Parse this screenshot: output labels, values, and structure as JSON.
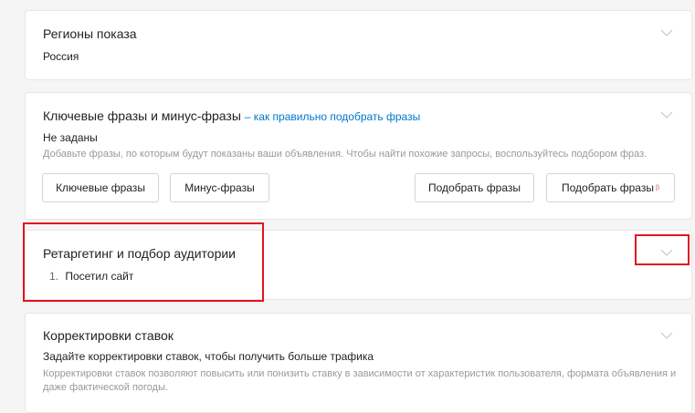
{
  "regions": {
    "title": "Регионы показа",
    "value": "Россия"
  },
  "keywords": {
    "title": "Ключевые фразы и минус-фразы",
    "link": "– как правильно подобрать фразы",
    "status": "Не заданы",
    "hint": "Добавьте фразы, по которым будут показаны ваши объявления. Чтобы найти похожие запросы, воспользуйтесь подбором фраз.",
    "buttons": {
      "keywords": "Ключевые фразы",
      "minus": "Минус-фразы",
      "pick": "Подобрать фразы",
      "pick_beta": "Подобрать фразы",
      "beta_mark": "β"
    }
  },
  "retargeting": {
    "title": "Ретаргетинг и подбор аудитории",
    "items": [
      {
        "num": "1.",
        "label": "Посетил сайт"
      }
    ]
  },
  "bids": {
    "title": "Корректировки ставок",
    "subtitle": "Задайте корректировки ставок, чтобы получить больше трафика",
    "hint": "Корректировки ставок позволяют повысить или понизить ставку в зависимости от характеристик пользователя, формата объявления и даже фактической погоды."
  },
  "colors": {
    "highlight": "#e0161e",
    "link": "#0077cc"
  }
}
